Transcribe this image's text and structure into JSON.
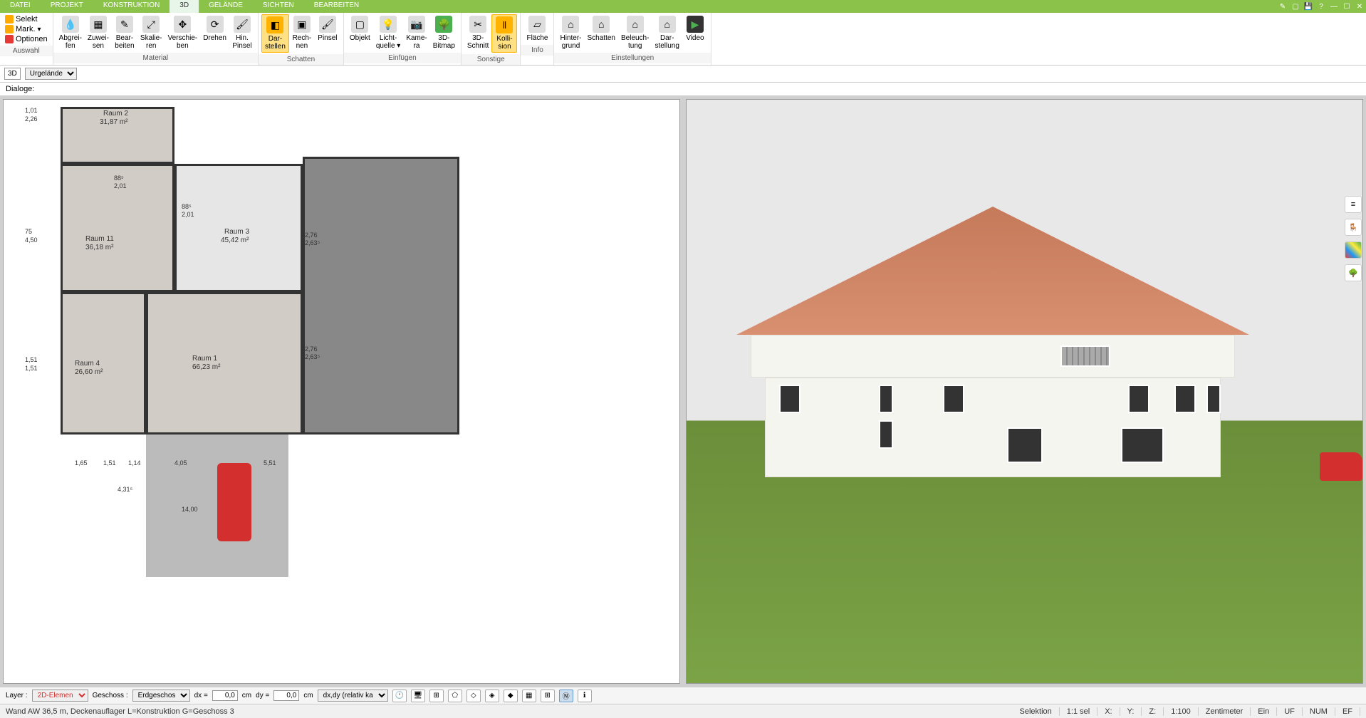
{
  "menu": {
    "items": [
      "DATEI",
      "PROJEKT",
      "KONSTRUKTION",
      "3D",
      "GELÄNDE",
      "SICHTEN",
      "BEARBEITEN"
    ],
    "active_index": 3
  },
  "ribbon": {
    "auswahl": {
      "label": "Auswahl",
      "selekt": "Selekt",
      "mark": "Mark.",
      "optionen": "Optionen"
    },
    "material": {
      "label": "Material",
      "buttons": [
        {
          "label": "Abgrei-\nfen"
        },
        {
          "label": "Zuwei-\nsen"
        },
        {
          "label": "Bear-\nbeiten"
        },
        {
          "label": "Skalie-\nren"
        },
        {
          "label": "Verschie-\nben"
        },
        {
          "label": "Drehen"
        },
        {
          "label": "Hin.\nPinsel"
        }
      ]
    },
    "schatten": {
      "label": "Schatten",
      "buttons": [
        {
          "label": "Dar-\nstellen",
          "active": true
        },
        {
          "label": "Rech-\nnen"
        },
        {
          "label": "Pinsel"
        }
      ]
    },
    "einfuegen": {
      "label": "Einfügen",
      "buttons": [
        {
          "label": "Objekt"
        },
        {
          "label": "Licht-\nquelle ▾"
        },
        {
          "label": "Kame-\nra"
        },
        {
          "label": "3D-\nBitmap"
        }
      ]
    },
    "sonstige": {
      "label": "Sonstige",
      "buttons": [
        {
          "label": "3D-\nSchnitt"
        },
        {
          "label": "Kolli-\nsion",
          "active": true
        }
      ]
    },
    "info": {
      "label": "Info",
      "buttons": [
        {
          "label": "Fläche"
        }
      ]
    },
    "einstellungen": {
      "label": "Einstellungen",
      "buttons": [
        {
          "label": "Hinter-\ngrund"
        },
        {
          "label": "Schatten"
        },
        {
          "label": "Beleuch-\ntung"
        },
        {
          "label": "Dar-\nstellung"
        },
        {
          "label": "Video"
        }
      ]
    }
  },
  "subbar": {
    "mode": "3D",
    "dropdown": "Urgelände"
  },
  "dialog_label": "Dialoge:",
  "plan": {
    "rooms": [
      {
        "name": "Raum 2",
        "area": "31,87 m²"
      },
      {
        "name": "Raum 11",
        "area": "36,18 m²"
      },
      {
        "name": "Raum 3",
        "area": "45,42 m²"
      },
      {
        "name": "Raum 4",
        "area": "26,60 m²"
      },
      {
        "name": "Raum 1",
        "area": "66,23 m²"
      }
    ],
    "dims": [
      "1,01",
      "2,26",
      "75",
      "4,50",
      "1,51",
      "1,51",
      "88⁵",
      "2,01",
      "88⁵",
      "2,01",
      "2,76",
      "2,63⁵",
      "2,76",
      "2,63⁵",
      "1,65",
      "1,51",
      "1,14",
      "4,05",
      "5,51",
      "4,31⁵",
      "14,00"
    ]
  },
  "bottombar": {
    "layer_label": "Layer :",
    "layer_value": "2D-Elemen",
    "geschoss_label": "Geschoss :",
    "geschoss_value": "Erdgeschos",
    "dx_label": "dx =",
    "dx_value": "0,0",
    "dy_label": "dy =",
    "dy_value": "0,0",
    "unit": "cm",
    "relative": "dx,dy (relativ ka"
  },
  "status": {
    "left": "Wand AW 36,5 m, Deckenauflager L=Konstruktion G=Geschoss 3",
    "selektion": "Selektion",
    "scale": "1:1 sel",
    "x": "X:",
    "y": "Y:",
    "z": "Z:",
    "zoom": "1:100",
    "unit": "Zentimeter",
    "ein": "Ein",
    "uf": "UF",
    "num": "NUM",
    "ef": "EF"
  }
}
